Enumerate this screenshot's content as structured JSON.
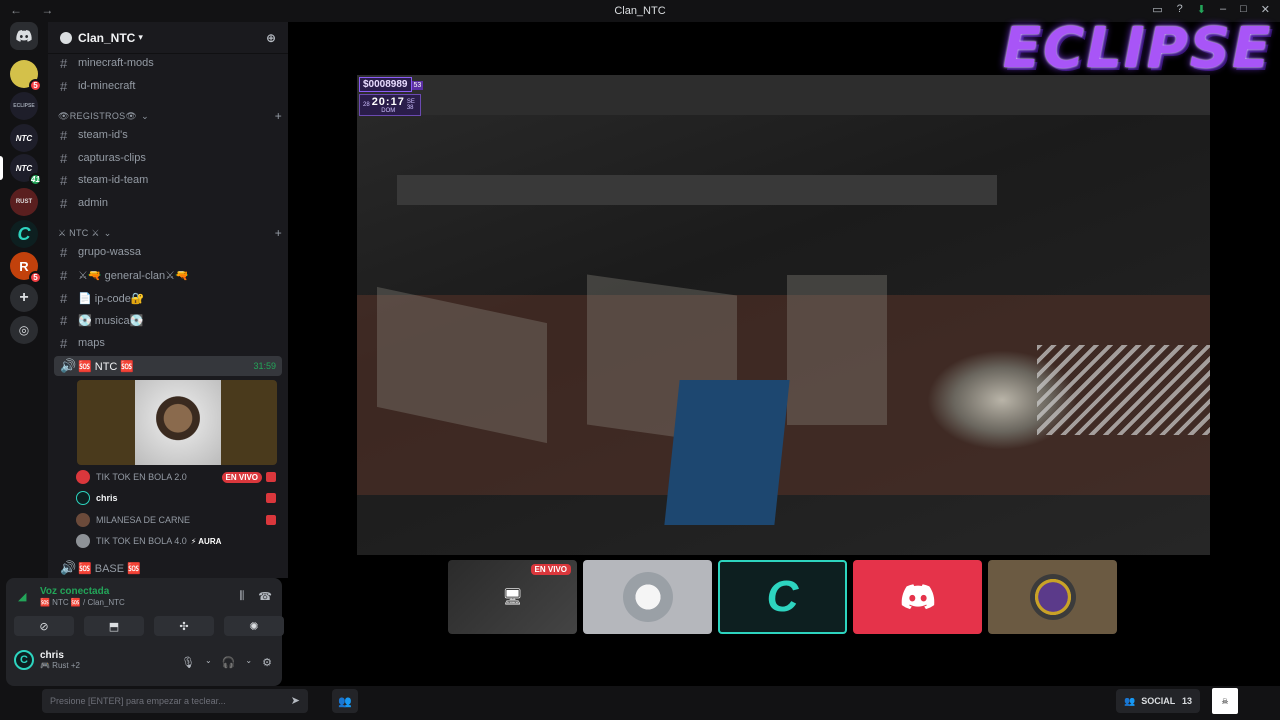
{
  "titlebar": {
    "title": "Clan_NTC",
    "nav": "← →",
    "controls": [
      "▭",
      "?",
      "⬇",
      "–",
      "□",
      "✕"
    ]
  },
  "guilds": [
    {
      "label": "",
      "badge": "5",
      "color": "#d4c14a"
    },
    {
      "label": "ECLIPSE",
      "badge": "",
      "color": "#1e1e2a"
    },
    {
      "label": "NTC",
      "badge": "",
      "color": "#1e1e2a"
    },
    {
      "label": "NTC",
      "badge": "41",
      "color": "#1e1e2a"
    },
    {
      "label": "RUST",
      "badge": "",
      "color": "#5a1f1f"
    },
    {
      "label": "C",
      "badge": "",
      "color": "#0d1f20"
    },
    {
      "label": "R",
      "badge": "5",
      "color": "#c2410c"
    }
  ],
  "server": {
    "name": "Clan_NTC"
  },
  "channels": {
    "top": [
      "minecraft-mods",
      "id-minecraft"
    ],
    "cat_registros": "👁REGISTROS👁",
    "registros": [
      "steam-id's",
      "capturas-clips",
      "steam-id-team",
      "admin"
    ],
    "cat_ntc": "⚔ NTC ⚔",
    "ntc": [
      "grupo-wassa",
      "⚔🔫 general-clan⚔🔫",
      "📄 ip-code🔐",
      "💽 musica💽",
      "maps"
    ],
    "voice_ntc": "🆘 NTC 🆘",
    "voice_time": "31:59",
    "voice_base": "🆘 BASE 🆘"
  },
  "voice_users": [
    {
      "name": "TIK TOK EN BOLA 2.0",
      "live": "EN VIVO"
    },
    {
      "name": "chris",
      "live": ""
    },
    {
      "name": "MILANESA DE CARNE",
      "live": ""
    },
    {
      "name": "TIK TOK EN BOLA 4.0",
      "live": "",
      "tag": "⚡ AURA"
    }
  ],
  "voicepanel": {
    "title": "Voz conectada",
    "sub": "🆘 NTC 🆘 / Clan_NTC"
  },
  "user": {
    "name": "chris",
    "status": "🎮 Rust +2",
    "avatar": "C"
  },
  "hud": {
    "money": "$0008989",
    "level": "53",
    "time": "20:17",
    "day_left": "28",
    "day_name": "DOM",
    "day_right": "38",
    "right_top": "SE"
  },
  "overlay": {
    "logo": "ECLIPSE"
  },
  "thumbs": [
    {
      "live": "EN VIVO"
    },
    {
      "live": ""
    },
    {
      "live": "",
      "letter": "C"
    },
    {
      "live": ""
    },
    {
      "live": ""
    }
  ],
  "bottombar": {
    "input_placeholder": "Presione [ENTER] para empezar a teclear...",
    "social_label": "SOCIAL",
    "social_count": "13"
  }
}
